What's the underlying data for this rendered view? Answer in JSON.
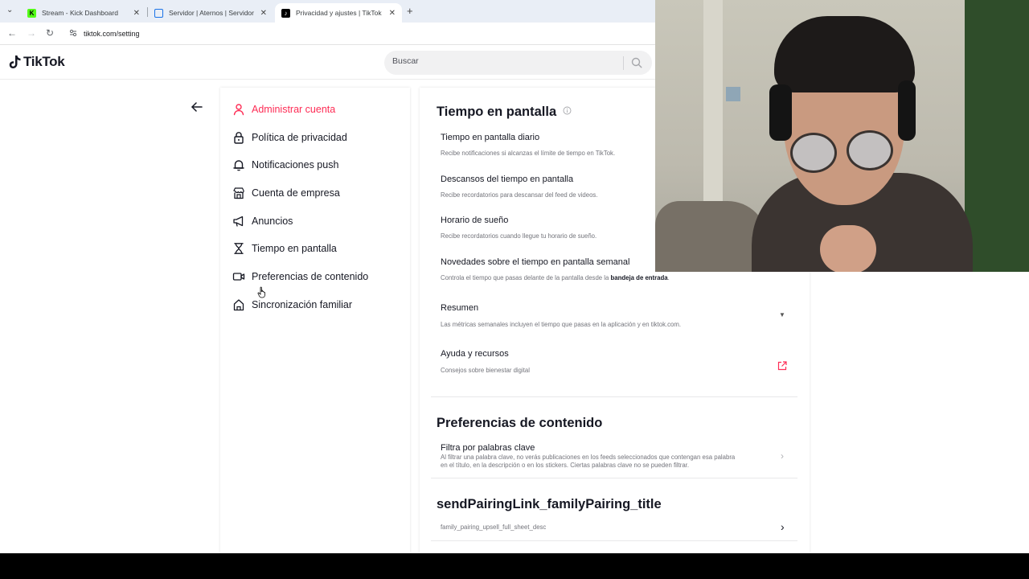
{
  "browser": {
    "tabs": [
      {
        "title": "Stream - Kick Dashboard",
        "favicon": "kick-icon",
        "favicon_color": "#53fc18"
      },
      {
        "title": "Servidor | Aternos | Servidor de",
        "favicon": "aternos-icon",
        "favicon_color": "#1a73e8"
      },
      {
        "title": "Privacidad y ajustes | TikTok",
        "favicon": "tiktok-icon",
        "favicon_color": "#000000"
      }
    ],
    "new_tab": "+",
    "url": "tiktok.com/setting"
  },
  "header": {
    "logo": "TikTok",
    "search_placeholder": "Buscar"
  },
  "sidebar": {
    "items": [
      {
        "label": "Administrar cuenta",
        "icon": "user-icon",
        "active": true
      },
      {
        "label": "Política de privacidad",
        "icon": "lock-icon"
      },
      {
        "label": "Notificaciones push",
        "icon": "bell-icon"
      },
      {
        "label": "Cuenta de empresa",
        "icon": "store-icon"
      },
      {
        "label": "Anuncios",
        "icon": "megaphone-icon"
      },
      {
        "label": "Tiempo en pantalla",
        "icon": "hourglass-icon"
      },
      {
        "label": "Preferencias de contenido",
        "icon": "video-icon"
      },
      {
        "label": "Sincronización familiar",
        "icon": "home-icon"
      }
    ]
  },
  "screen_time": {
    "title": "Tiempo en pantalla",
    "rows": [
      {
        "title": "Tiempo en pantalla diario",
        "desc": "Recibe notificaciones si alcanzas el límite de tiempo en TikTok."
      },
      {
        "title": "Descansos del tiempo en pantalla",
        "desc": "Recibe recordatorios para descansar del feed de videos."
      },
      {
        "title": "Horario de sueño",
        "desc": "Recibe recordatorios cuando llegue tu horario de sueño."
      },
      {
        "title": "Novedades sobre el tiempo en pantalla semanal",
        "desc": "Controla el tiempo que pasas delante de la pantalla desde la",
        "desc_bold": "bandeja de entrada",
        "desc_end": "."
      },
      {
        "title": "Resumen",
        "desc": "Las métricas semanales incluyen el tiempo que pasas en la aplicación y en tiktok.com."
      },
      {
        "title": "Ayuda y recursos",
        "desc": "Consejos sobre bienestar digital"
      }
    ]
  },
  "content_prefs": {
    "title": "Preferencias de contenido",
    "row_title": "Filtra por palabras clave",
    "row_desc_1": "Al filtrar una palabra clave, no verás publicaciones en los feeds seleccionados que contengan esa palabra",
    "row_desc_2": "en el título, en la descripción o en los stickers. Ciertas palabras clave no se pueden filtrar."
  },
  "family": {
    "title": "sendPairingLink_familyPairing_title",
    "desc": "family_pairing_upsell_full_sheet_desc"
  },
  "colors": {
    "accent": "#fe2c55",
    "text": "#161823"
  }
}
